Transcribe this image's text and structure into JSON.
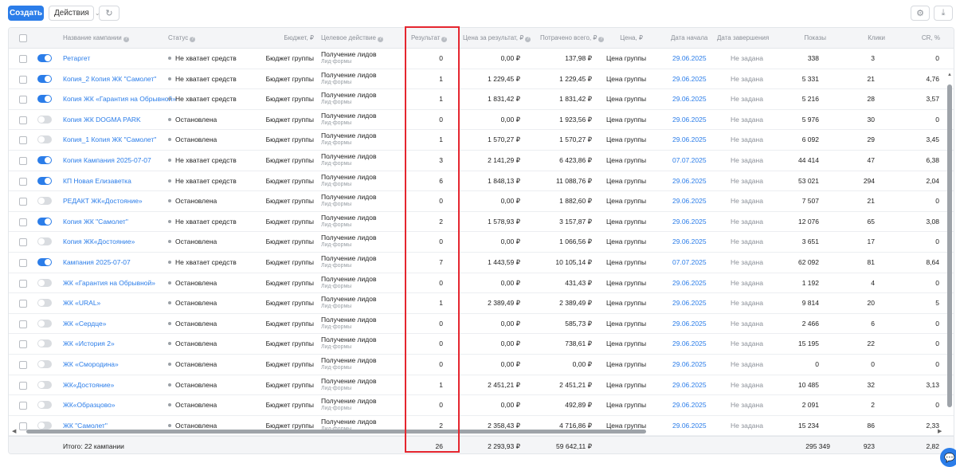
{
  "toolbar": {
    "create": "Создать",
    "actions": "Действия"
  },
  "icons": {
    "refresh": "refresh-icon",
    "settings": "gear-icon",
    "download": "download-icon",
    "chevron": "chevron-down-icon",
    "chat": "chat-icon"
  },
  "accent": "#2b7de9",
  "highlight_color": "#e5262f",
  "headers": {
    "name": "Название кампании",
    "status": "Статус",
    "budget": "Бюджет, ₽",
    "goal": "Целевое действие",
    "result": "Результат",
    "price_per_result": "Цена за результат, ₽",
    "spent": "Потрачено всего, ₽",
    "price": "Цена, ₽",
    "start": "Дата начала",
    "end": "Дата завершения",
    "impressions": "Показы",
    "clicks": "Клики",
    "cr": "CR, %"
  },
  "rows": [
    {
      "on": true,
      "name": "Ретаргет",
      "status": "Не хватает средств",
      "budget": "Бюджет группы",
      "goal": "Получение лидов",
      "goal_sub": "Лид-формы",
      "result": "0",
      "ppr": "0,00 ₽",
      "spent": "137,98 ₽",
      "price": "Цена группы",
      "start": "29.06.2025",
      "end": "Не задана",
      "impr": "338",
      "clicks": "3",
      "cr": "0"
    },
    {
      "on": true,
      "name": "Копия_2 Копия ЖК \"Самолет\"",
      "status": "Не хватает средств",
      "budget": "Бюджет группы",
      "goal": "Получение лидов",
      "goal_sub": "Лид-формы",
      "result": "1",
      "ppr": "1 229,45 ₽",
      "spent": "1 229,45 ₽",
      "price": "Цена группы",
      "start": "29.06.2025",
      "end": "Не задана",
      "impr": "5 331",
      "clicks": "21",
      "cr": "4,76"
    },
    {
      "on": true,
      "name": "Копия ЖК «Гарантия на Обрывной»",
      "status": "Не хватает средств",
      "budget": "Бюджет группы",
      "goal": "Получение лидов",
      "goal_sub": "Лид-формы",
      "result": "1",
      "ppr": "1 831,42 ₽",
      "spent": "1 831,42 ₽",
      "price": "Цена группы",
      "start": "29.06.2025",
      "end": "Не задана",
      "impr": "5 216",
      "clicks": "28",
      "cr": "3,57"
    },
    {
      "on": false,
      "name": "Копия ЖК DOGMA PARK",
      "status": "Остановлена",
      "budget": "Бюджет группы",
      "goal": "Получение лидов",
      "goal_sub": "Лид-формы",
      "result": "0",
      "ppr": "0,00 ₽",
      "spent": "1 923,56 ₽",
      "price": "Цена группы",
      "start": "29.06.2025",
      "end": "Не задана",
      "impr": "5 976",
      "clicks": "30",
      "cr": "0"
    },
    {
      "on": false,
      "name": "Копия_1 Копия ЖК \"Самолет\"",
      "status": "Остановлена",
      "budget": "Бюджет группы",
      "goal": "Получение лидов",
      "goal_sub": "Лид-формы",
      "result": "1",
      "ppr": "1 570,27 ₽",
      "spent": "1 570,27 ₽",
      "price": "Цена группы",
      "start": "29.06.2025",
      "end": "Не задана",
      "impr": "6 092",
      "clicks": "29",
      "cr": "3,45"
    },
    {
      "on": true,
      "name": "Копия Кампания 2025-07-07",
      "status": "Не хватает средств",
      "budget": "Бюджет группы",
      "goal": "Получение лидов",
      "goal_sub": "Лид-формы",
      "result": "3",
      "ppr": "2 141,29 ₽",
      "spent": "6 423,86 ₽",
      "price": "Цена группы",
      "start": "07.07.2025",
      "end": "Не задана",
      "impr": "44 414",
      "clicks": "47",
      "cr": "6,38"
    },
    {
      "on": true,
      "name": "КП Новая Елизаветка",
      "status": "Не хватает средств",
      "budget": "Бюджет группы",
      "goal": "Получение лидов",
      "goal_sub": "Лид-формы",
      "result": "6",
      "ppr": "1 848,13 ₽",
      "spent": "11 088,76 ₽",
      "price": "Цена группы",
      "start": "29.06.2025",
      "end": "Не задана",
      "impr": "53 021",
      "clicks": "294",
      "cr": "2,04"
    },
    {
      "on": false,
      "name": "РЕДАКТ ЖК«Достояние»",
      "status": "Остановлена",
      "budget": "Бюджет группы",
      "goal": "Получение лидов",
      "goal_sub": "Лид-формы",
      "result": "0",
      "ppr": "0,00 ₽",
      "spent": "1 882,60 ₽",
      "price": "Цена группы",
      "start": "29.06.2025",
      "end": "Не задана",
      "impr": "7 507",
      "clicks": "21",
      "cr": "0"
    },
    {
      "on": true,
      "name": "Копия ЖК \"Самолет\"",
      "status": "Не хватает средств",
      "budget": "Бюджет группы",
      "goal": "Получение лидов",
      "goal_sub": "Лид-формы",
      "result": "2",
      "ppr": "1 578,93 ₽",
      "spent": "3 157,87 ₽",
      "price": "Цена группы",
      "start": "29.06.2025",
      "end": "Не задана",
      "impr": "12 076",
      "clicks": "65",
      "cr": "3,08"
    },
    {
      "on": false,
      "name": "Копия ЖК«Достояние»",
      "status": "Остановлена",
      "budget": "Бюджет группы",
      "goal": "Получение лидов",
      "goal_sub": "Лид-формы",
      "result": "0",
      "ppr": "0,00 ₽",
      "spent": "1 066,56 ₽",
      "price": "Цена группы",
      "start": "29.06.2025",
      "end": "Не задана",
      "impr": "3 651",
      "clicks": "17",
      "cr": "0"
    },
    {
      "on": true,
      "name": "Кампания 2025-07-07",
      "status": "Не хватает средств",
      "budget": "Бюджет группы",
      "goal": "Получение лидов",
      "goal_sub": "Лид-формы",
      "result": "7",
      "ppr": "1 443,59 ₽",
      "spent": "10 105,14 ₽",
      "price": "Цена группы",
      "start": "07.07.2025",
      "end": "Не задана",
      "impr": "62 092",
      "clicks": "81",
      "cr": "8,64"
    },
    {
      "on": false,
      "name": "ЖК «Гарантия на Обрывной»",
      "status": "Остановлена",
      "budget": "Бюджет группы",
      "goal": "Получение лидов",
      "goal_sub": "Лид-формы",
      "result": "0",
      "ppr": "0,00 ₽",
      "spent": "431,43 ₽",
      "price": "Цена группы",
      "start": "29.06.2025",
      "end": "Не задана",
      "impr": "1 192",
      "clicks": "4",
      "cr": "0"
    },
    {
      "on": false,
      "name": "ЖК «URAL»",
      "status": "Остановлена",
      "budget": "Бюджет группы",
      "goal": "Получение лидов",
      "goal_sub": "Лид-формы",
      "result": "1",
      "ppr": "2 389,49 ₽",
      "spent": "2 389,49 ₽",
      "price": "Цена группы",
      "start": "29.06.2025",
      "end": "Не задана",
      "impr": "9 814",
      "clicks": "20",
      "cr": "5"
    },
    {
      "on": false,
      "name": "ЖК «Сердце»",
      "status": "Остановлена",
      "budget": "Бюджет группы",
      "goal": "Получение лидов",
      "goal_sub": "Лид-формы",
      "result": "0",
      "ppr": "0,00 ₽",
      "spent": "585,73 ₽",
      "price": "Цена группы",
      "start": "29.06.2025",
      "end": "Не задана",
      "impr": "2 466",
      "clicks": "6",
      "cr": "0"
    },
    {
      "on": false,
      "name": "ЖК «История 2»",
      "status": "Остановлена",
      "budget": "Бюджет группы",
      "goal": "Получение лидов",
      "goal_sub": "Лид-формы",
      "result": "0",
      "ppr": "0,00 ₽",
      "spent": "738,61 ₽",
      "price": "Цена группы",
      "start": "29.06.2025",
      "end": "Не задана",
      "impr": "15 195",
      "clicks": "22",
      "cr": "0"
    },
    {
      "on": false,
      "name": "ЖК «Смородина»",
      "status": "Остановлена",
      "budget": "Бюджет группы",
      "goal": "Получение лидов",
      "goal_sub": "Лид-формы",
      "result": "0",
      "ppr": "0,00 ₽",
      "spent": "0,00 ₽",
      "price": "Цена группы",
      "start": "29.06.2025",
      "end": "Не задана",
      "impr": "0",
      "clicks": "0",
      "cr": "0"
    },
    {
      "on": false,
      "name": "ЖК«Достояние»",
      "status": "Остановлена",
      "budget": "Бюджет группы",
      "goal": "Получение лидов",
      "goal_sub": "Лид-формы",
      "result": "1",
      "ppr": "2 451,21 ₽",
      "spent": "2 451,21 ₽",
      "price": "Цена группы",
      "start": "29.06.2025",
      "end": "Не задана",
      "impr": "10 485",
      "clicks": "32",
      "cr": "3,13"
    },
    {
      "on": false,
      "name": "ЖК«Образцово»",
      "status": "Остановлена",
      "budget": "Бюджет группы",
      "goal": "Получение лидов",
      "goal_sub": "Лид-формы",
      "result": "0",
      "ppr": "0,00 ₽",
      "spent": "492,89 ₽",
      "price": "Цена группы",
      "start": "29.06.2025",
      "end": "Не задана",
      "impr": "2 091",
      "clicks": "2",
      "cr": "0"
    },
    {
      "on": false,
      "name": "ЖК \"Самолет\"",
      "status": "Остановлена",
      "budget": "Бюджет группы",
      "goal": "Получение лидов",
      "goal_sub": "Лид-формы",
      "result": "2",
      "ppr": "2 358,43 ₽",
      "spent": "4 716,86 ₽",
      "price": "Цена группы",
      "start": "29.06.2025",
      "end": "Не задана",
      "impr": "15 234",
      "clicks": "86",
      "cr": "2,33"
    }
  ],
  "footer": {
    "total_label": "Итого: 22 кампании",
    "result": "26",
    "ppr": "2 293,93 ₽",
    "spent": "59 642,11 ₽",
    "impr": "295 349",
    "clicks": "923",
    "cr": "2,82"
  }
}
